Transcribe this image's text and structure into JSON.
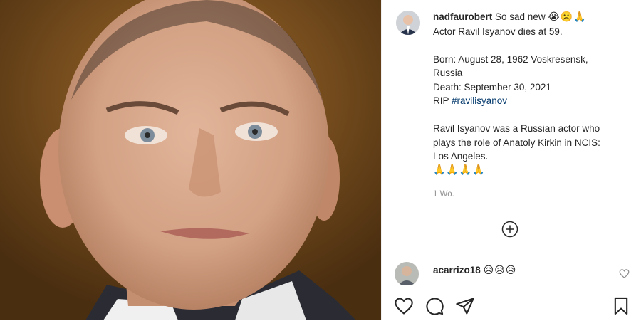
{
  "post": {
    "author": "nadfaurobert",
    "caption_lines": [
      {
        "text": "So sad new",
        "emoji": "😭☹️🙏"
      },
      {
        "text": "Actor Ravil Isyanov dies at 59."
      }
    ],
    "details": [
      "Born: August 28, 1962 Voskresensk,",
      "Russia",
      "Death: September 30, 2021"
    ],
    "rip_prefix": "RIP ",
    "hashtag": "#ravilisyanov",
    "bio": [
      "Ravil Isyanov was a Russian actor who",
      "plays the role of Anatoly Kirkin in NCIS:",
      "Los Angeles."
    ],
    "prayer_emoji": "🙏🙏🙏🙏",
    "time_ago": "1 Wo."
  },
  "comment": {
    "author": "acarrizo18",
    "emoji": "😥😥😥"
  },
  "icons": {
    "load_more": "plus-circle-icon",
    "like": "heart-icon",
    "comment": "comment-bubble-icon",
    "share": "paper-plane-icon",
    "save": "bookmark-icon"
  },
  "colors": {
    "hashtag": "#00376b",
    "muted": "#8e8e8e",
    "text": "#262626"
  }
}
